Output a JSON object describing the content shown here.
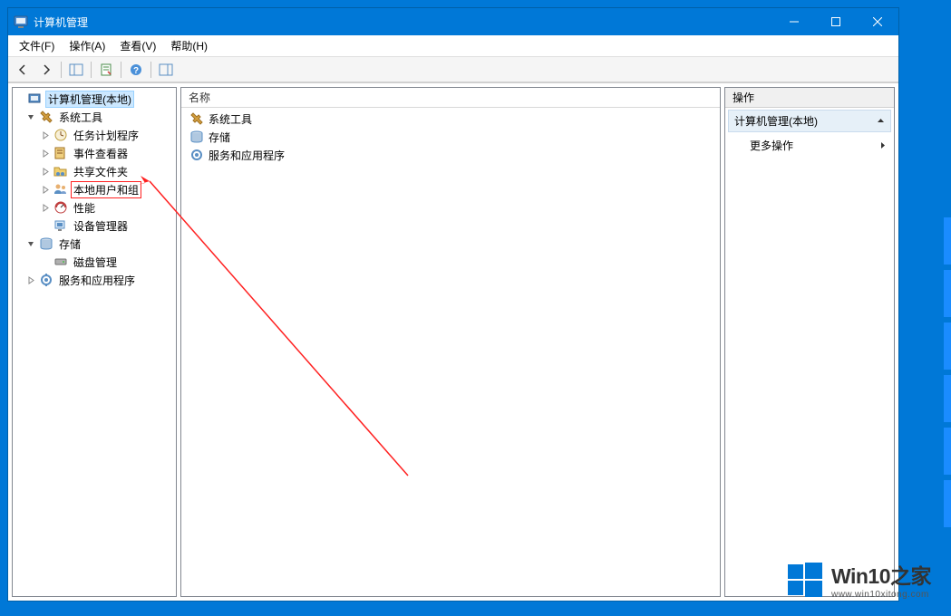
{
  "window": {
    "title": "计算机管理"
  },
  "menu": {
    "file": "文件(F)",
    "action": "操作(A)",
    "view": "查看(V)",
    "help": "帮助(H)"
  },
  "tree": {
    "root": "计算机管理(本地)",
    "systemTools": "系统工具",
    "taskScheduler": "任务计划程序",
    "eventViewer": "事件查看器",
    "sharedFolders": "共享文件夹",
    "localUsersGroups": "本地用户和组",
    "performance": "性能",
    "deviceManager": "设备管理器",
    "storage": "存储",
    "diskManagement": "磁盘管理",
    "servicesApps": "服务和应用程序"
  },
  "list": {
    "header": "名称",
    "items": [
      "系统工具",
      "存储",
      "服务和应用程序"
    ]
  },
  "actions": {
    "header": "操作",
    "section": "计算机管理(本地)",
    "more": "更多操作"
  },
  "watermark": {
    "title": "Win10之家",
    "url": "www.win10xitong.com"
  }
}
